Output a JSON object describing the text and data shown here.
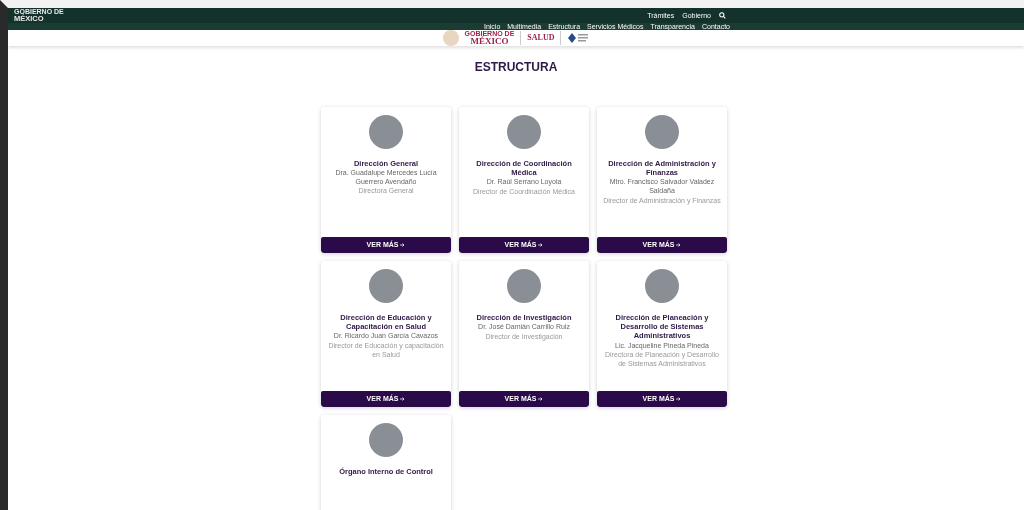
{
  "top_bar": {
    "logo_small": [
      "GOBIERNO DE",
      "MÉXICO"
    ],
    "links": [
      "Trámites",
      "Gobierno"
    ]
  },
  "nav": {
    "items": [
      "Inicio",
      "Multimedia",
      "Estructura",
      "Servicios Médicos",
      "Transparencia",
      "Contacto"
    ]
  },
  "logos": {
    "gobierno": [
      "GOBIERNO DE",
      "MÉXICO"
    ],
    "salud": "SALUD"
  },
  "page_title": "ESTRUCTURA",
  "cards": [
    {
      "title": "Dirección General",
      "name": "Dra. Guadalupe Mercedes Lucía Guerrero Avendaño",
      "role": "Directora General",
      "button": "VER MÁS"
    },
    {
      "title": "Dirección de Coordinación Médica",
      "name": "Dr. Raúl Serrano Loyola",
      "role": "Director de Coordinación Médica",
      "button": "VER MÁS"
    },
    {
      "title": "Dirección de Administración y Finanzas",
      "name": "Mtro. Francisco Salvador Valadez Saldaña",
      "role": "Director de Administración y Finanzas",
      "button": "VER MÁS"
    },
    {
      "title": "Dirección de Educación y Capacitación en Salud",
      "name": "Dr. Ricardo Juan García Cavazos",
      "role": "Director de Educación y capacitación en Salud",
      "button": "VER MÁS"
    },
    {
      "title": "Dirección de Investigación",
      "name": "Dr. José Damián Carrillo Ruiz",
      "role": "Director de Investigación",
      "button": "VER MÁS"
    },
    {
      "title": "Dirección de Planeación y Desarrollo de Sistemas Administrativos",
      "name": "Lic. Jacqueline Pineda Pineda",
      "role": "Directora de Planeación y Desarrollo de Sistemas Administrativos",
      "button": "VER MÁS"
    },
    {
      "title": "Órgano Interno de Control"
    }
  ]
}
